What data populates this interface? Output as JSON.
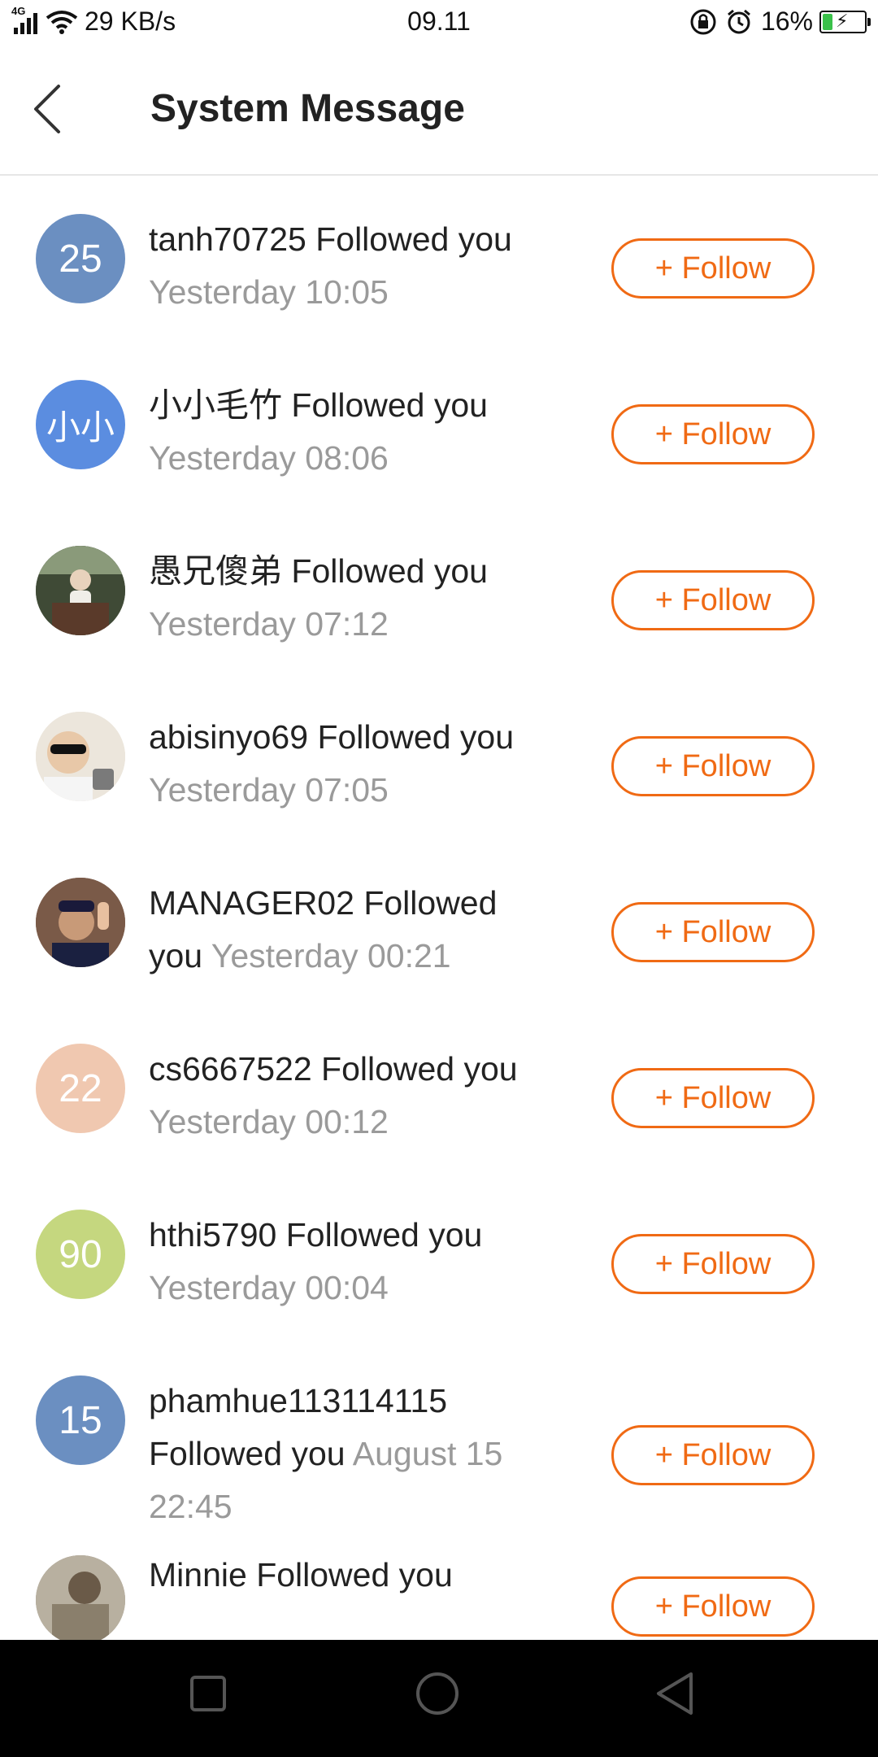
{
  "status_bar": {
    "network": "4G",
    "speed": "29 KB/s",
    "time": "09.11",
    "battery": "16%"
  },
  "header": {
    "title": "System Message"
  },
  "colors": {
    "accent": "#f06a14",
    "time_text": "#9a9a9a"
  },
  "messages": [
    {
      "user": "tanh70725",
      "action": "Followed you",
      "time": "Yesterday 10:05",
      "avatar_text": "25",
      "avatar_color": "#6b8fc1",
      "button": "+ Follow"
    },
    {
      "user": "小小毛竹",
      "action": "Followed you",
      "time": "Yesterday 08:06",
      "avatar_text": "小小",
      "avatar_color": "#5b8de0",
      "button": "+ Follow"
    },
    {
      "user": "愚兄傻弟",
      "action": "Followed you",
      "time": "Yesterday 07:12",
      "avatar_text": "",
      "avatar_color": "#4a5540",
      "button": "+ Follow"
    },
    {
      "user": "abisinyo69",
      "action": "Followed you",
      "time": "Yesterday 07:05",
      "avatar_text": "",
      "avatar_color": "#d9d2c6",
      "button": "+ Follow"
    },
    {
      "user": "MANAGER02",
      "action": "Followed you",
      "time": "Yesterday 00:21",
      "avatar_text": "",
      "avatar_color": "#6a4a3a",
      "button": "+ Follow"
    },
    {
      "user": "cs6667522",
      "action": "Followed you",
      "time": "Yesterday 00:12",
      "avatar_text": "22",
      "avatar_color": "#f0c8b0",
      "button": "+ Follow"
    },
    {
      "user": "hthi5790",
      "action": "Followed you",
      "time": "Yesterday 00:04",
      "avatar_text": "90",
      "avatar_color": "#c5d77f",
      "button": "+ Follow"
    },
    {
      "user": "phamhue113114115",
      "action": "Followed you",
      "time": "August 15 22:45",
      "avatar_text": "15",
      "avatar_color": "#6b8fc1",
      "button": "+ Follow"
    },
    {
      "user": "Minnie",
      "action": "Followed you",
      "time": "",
      "avatar_text": "",
      "avatar_color": "#8a7f6c",
      "button": "+ Follow"
    }
  ]
}
